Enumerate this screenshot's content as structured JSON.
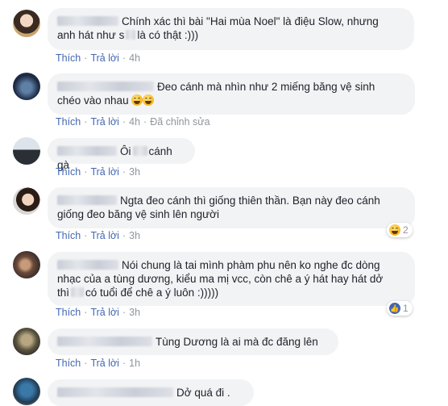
{
  "actions": {
    "like": "Thích",
    "reply": "Trả lời",
    "edited": "Đã chỉnh sửa",
    "dot": "·"
  },
  "comments": [
    {
      "line1_a": "Chính xác thì bài \"Hai mùa Noel\" là điệu Slow, nhưng",
      "line2_a": "anh hát như s",
      "line2_b": "là có thật :)))",
      "time": "4h"
    },
    {
      "line1_a": "Đeo cánh mà nhìn như 2 miếng băng vệ sinh",
      "line2_a": "chéo vào nhau",
      "time": "4h"
    },
    {
      "line1_a": "Ôi",
      "line1_b": "cánh gà",
      "time": "3h"
    },
    {
      "line1_a": "Ngta đeo cánh thì giống thiên thần. Bạn này đeo cánh",
      "line2_a": "giống đeo băng vệ sinh lên người",
      "time": "3h",
      "reaction_count": "2"
    },
    {
      "line1_a": "Nói chung là tai mình phàm phu nên ko nghe đc dòng",
      "line2_a": "nhạc của a tùng dương, kiểu ma mị vcc, còn chê a ý hát hay hát dở",
      "line3_a": "thì",
      "line3_b": "có tuổi để chê a ý luôn :)))))",
      "time": "3h",
      "reaction_count": "1"
    },
    {
      "line1_a": "Tùng Dương là ai mà đc đăng lên",
      "time": "1h"
    },
    {
      "line1_a": "Dở quá đi ."
    }
  ]
}
